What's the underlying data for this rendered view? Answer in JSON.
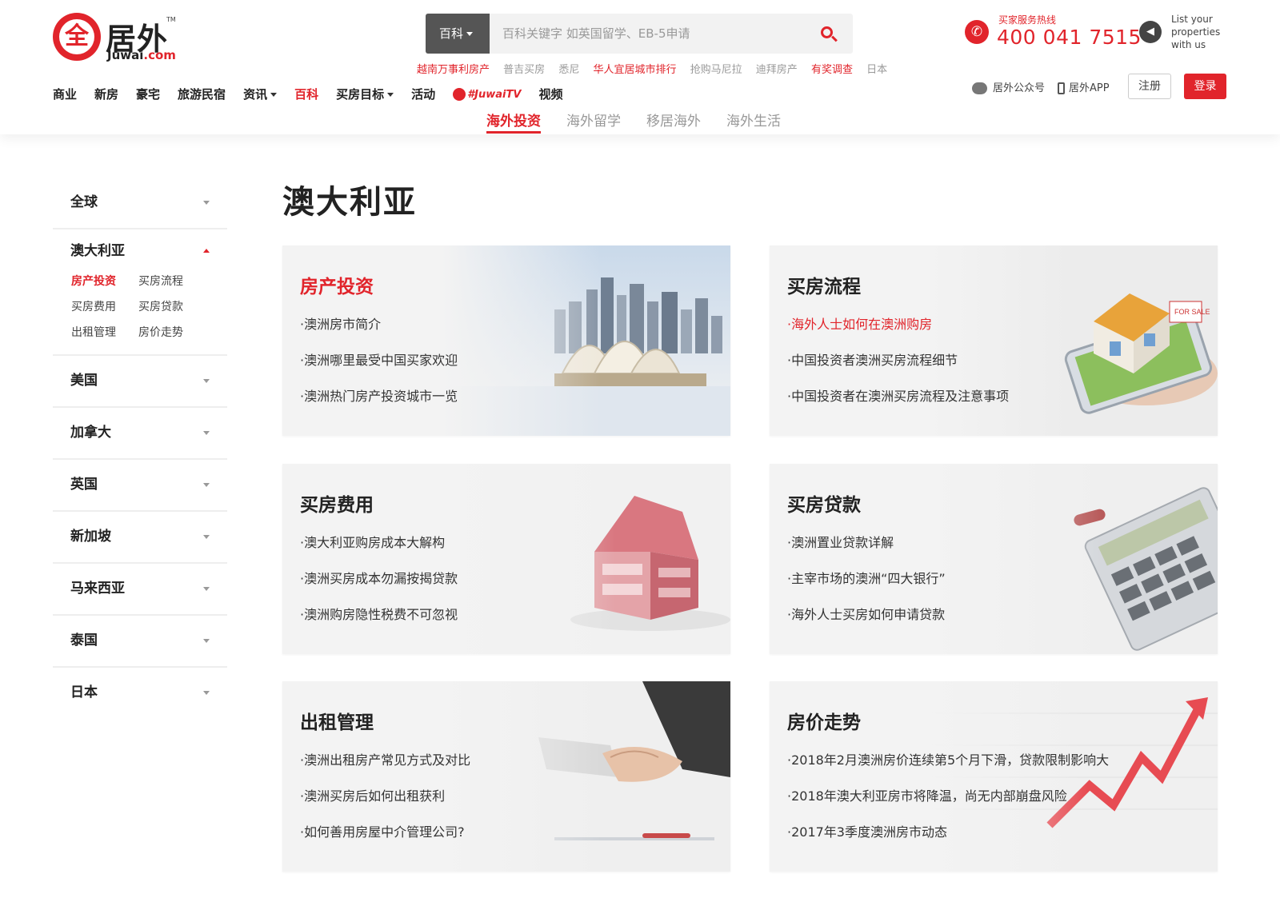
{
  "logo": {
    "mark": "全",
    "cn": "居外",
    "en_pre": "Juwai",
    "en_post": ".com",
    "tm": "TM"
  },
  "search": {
    "category": "百科",
    "placeholder": "百科关键字 如英国留学、EB-5申请"
  },
  "hot_links": [
    {
      "label": "越南万事利房产",
      "hot": true
    },
    {
      "label": "普吉买房",
      "hot": false
    },
    {
      "label": "悉尼",
      "hot": false
    },
    {
      "label": "华人宜居城市排行",
      "hot": true
    },
    {
      "label": "抢购马尼拉",
      "hot": false
    },
    {
      "label": "迪拜房产",
      "hot": false
    },
    {
      "label": "有奖调查",
      "hot": true
    },
    {
      "label": "日本",
      "hot": false
    }
  ],
  "hotline": {
    "label": "买家服务热线",
    "number": "400 041 7515"
  },
  "list_properties": "List your properties with us",
  "nav": [
    "商业",
    "新房",
    "豪宅",
    "旅游民宿",
    "资讯",
    "买房目标",
    "活动",
    "视频"
  ],
  "nav_extra": {
    "baike": "百科",
    "tv": "#JuwaiTV"
  },
  "account": {
    "wechat": "居外公众号",
    "app": "居外APP",
    "register": "注册",
    "login": "登录"
  },
  "subnav": [
    "海外投资",
    "海外留学",
    "移居海外",
    "海外生活"
  ],
  "sidebar": {
    "global": "全球",
    "open_country": "澳大利亚",
    "open_items": [
      "房产投资",
      "买房流程",
      "买房费用",
      "买房贷款",
      "出租管理",
      "房价走势"
    ],
    "countries": [
      "美国",
      "加拿大",
      "英国",
      "新加坡",
      "马来西亚",
      "泰国",
      "日本"
    ]
  },
  "page_title": "澳大利亚",
  "cards": [
    {
      "title": "房产投资",
      "links": [
        "·澳洲房市简介",
        "·澳洲哪里最受中国买家欢迎",
        "·澳洲热门房产投资城市一览"
      ]
    },
    {
      "title": "买房流程",
      "links": [
        "·海外人士如何在澳洲购房",
        "·中国投资者澳洲买房流程细节",
        "·中国投资者在澳洲买房流程及注意事项"
      ]
    },
    {
      "title": "买房费用",
      "links": [
        "·澳大利亚购房成本大解构",
        "·澳洲买房成本勿漏按揭贷款",
        "·澳洲购房隐性税费不可忽视"
      ]
    },
    {
      "title": "买房贷款",
      "links": [
        "·澳洲置业贷款详解",
        "·主宰市场的澳洲“四大银行”",
        "·海外人士买房如何申请贷款"
      ]
    },
    {
      "title": "出租管理",
      "links": [
        "·澳洲出租房产常见方式及对比",
        "·澳洲买房后如何出租获利",
        "·如何善用房屋中介管理公司?"
      ]
    },
    {
      "title": "房价走势",
      "links": [
        "·2018年2月澳洲房价连续第5个月下滑，贷款限制影响大",
        "·2018年澳大利亚房市将降温，尚无内部崩盘风险",
        "·2017年3季度澳洲房市动态"
      ]
    }
  ],
  "colors": {
    "brand_red": "#e1242b",
    "card_bg": "#f3f3f3"
  }
}
